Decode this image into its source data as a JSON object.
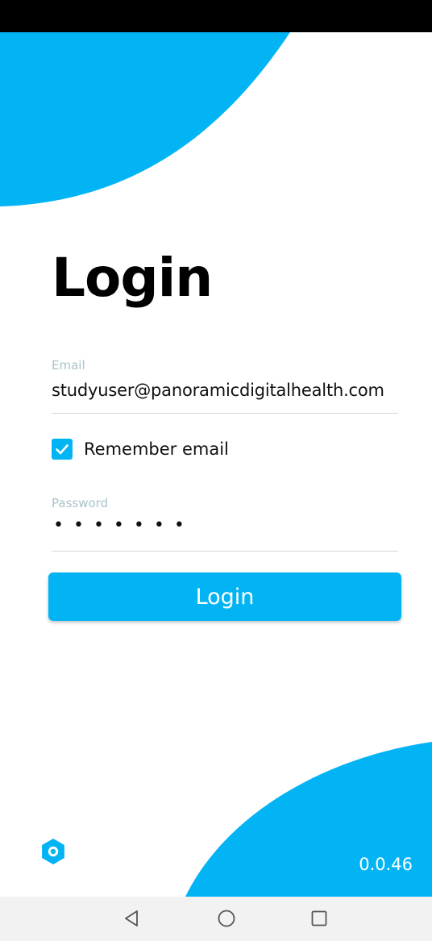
{
  "page": {
    "title": "Login"
  },
  "email_field": {
    "label": "Email",
    "value": "studyuser@panoramicdigitalhealth.com"
  },
  "remember_email": {
    "label": "Remember email",
    "checked": true
  },
  "password_field": {
    "label": "Password",
    "masked_value": "•••••••"
  },
  "login_button": {
    "label": "Login"
  },
  "footer": {
    "settings_icon": "gear-icon",
    "version": "0.0.46"
  },
  "navigation_bar": {
    "back_icon": "back-triangle-icon",
    "home_icon": "home-circle-icon",
    "recents_icon": "recents-square-icon"
  },
  "colors": {
    "accent": "#03b4f5",
    "status_bar": "#000000",
    "field_label": "#a9c3cc",
    "nav_bar": "#f2f2f2"
  }
}
